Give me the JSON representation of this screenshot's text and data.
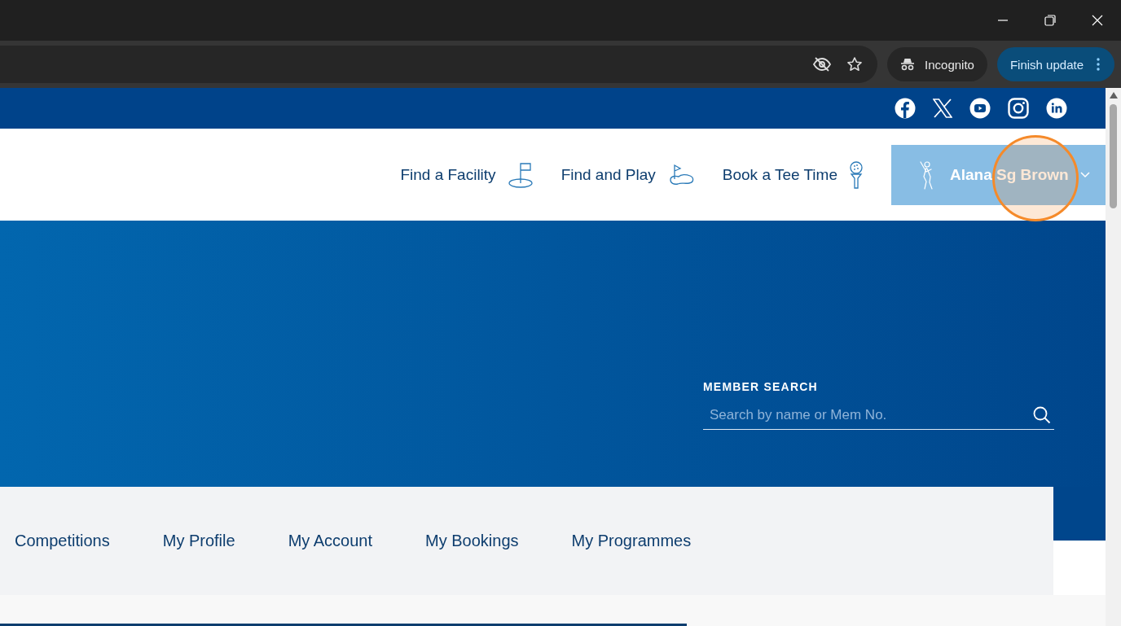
{
  "browser": {
    "incognito_label": "Incognito",
    "update_button": "Finish update"
  },
  "social_links": [
    {
      "kind": "facebook"
    },
    {
      "kind": "x"
    },
    {
      "kind": "youtube"
    },
    {
      "kind": "instagram"
    },
    {
      "kind": "linkedin"
    }
  ],
  "header_nav": [
    {
      "label": "Find a Facility",
      "kind": "flag"
    },
    {
      "label": "Find and Play",
      "kind": "green"
    },
    {
      "label": "Book a Tee Time",
      "kind": "tee"
    }
  ],
  "user_menu": {
    "name": "Alana Sg Brown",
    "expanded": false
  },
  "member_search": {
    "heading": "MEMBER SEARCH",
    "placeholder": "Search by name or Mem No."
  },
  "tabs": [
    {
      "label": "Competitions"
    },
    {
      "label": "My Profile"
    },
    {
      "label": "My Account"
    },
    {
      "label": "My Bookings"
    },
    {
      "label": "My Programmes"
    }
  ]
}
